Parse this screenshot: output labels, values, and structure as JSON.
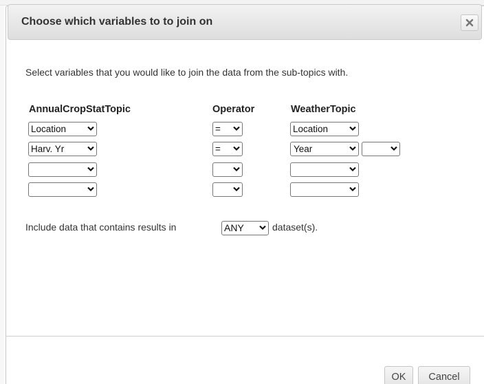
{
  "dialog": {
    "title": "Choose which variables to to join on",
    "close_icon": "close-icon",
    "instruction": "Select variables that you would like to join the data from the sub-topics with."
  },
  "columns": {
    "left": "AnnualCropStatTopic",
    "operator": "Operator",
    "right": "WeatherTopic"
  },
  "rows": [
    {
      "left": "Location",
      "operator": "=",
      "right": "Location",
      "extra": null
    },
    {
      "left": "Harv. Yr",
      "operator": "=",
      "right": "Year",
      "extra": ""
    },
    {
      "left": "",
      "operator": "",
      "right": "",
      "extra": null
    },
    {
      "left": "",
      "operator": "",
      "right": "",
      "extra": null
    }
  ],
  "include": {
    "prefix": "Include data that contains results in",
    "selected": "ANY",
    "suffix": "dataset(s)."
  },
  "buttons": {
    "ok": "OK",
    "cancel": "Cancel"
  }
}
